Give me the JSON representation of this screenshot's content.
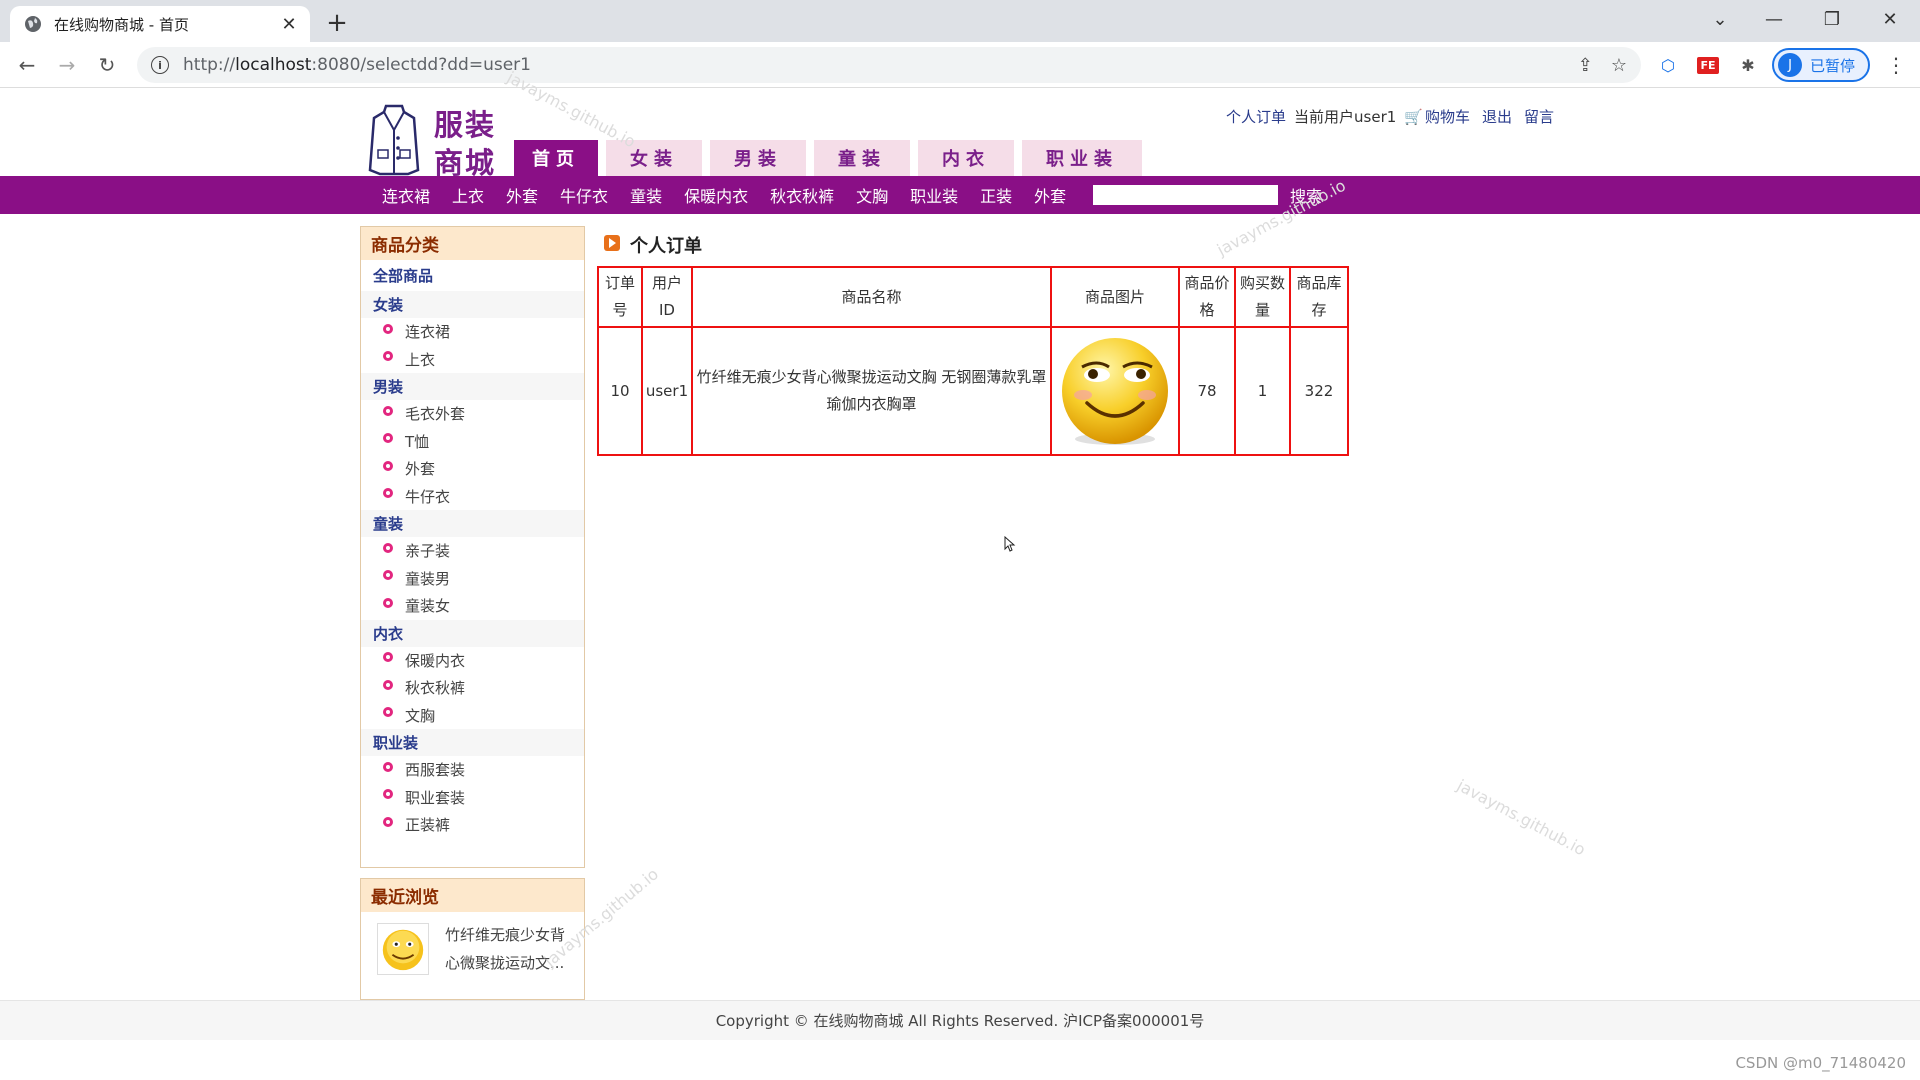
{
  "browser": {
    "tab_title": "在线购物商城 - 首页",
    "url_prefix": "http://",
    "url_host": "localhost",
    "url_rest": ":8080/selectdd?dd=user1",
    "profile_initial": "J",
    "profile_label": "已暂停",
    "ext_label": "FE"
  },
  "site": {
    "logo_line1": "服装",
    "logo_line2": "商城",
    "toplinks": {
      "my_orders": "个人订单",
      "current_user": "当前用户user1",
      "cart": "购物车",
      "logout": "退出",
      "message": "留言"
    },
    "main_tabs": [
      {
        "label": "首页"
      },
      {
        "label": "女装"
      },
      {
        "label": "男装"
      },
      {
        "label": "童装"
      },
      {
        "label": "内衣"
      },
      {
        "label": "职业装"
      }
    ],
    "sub_nav": [
      "连衣裙",
      "上衣",
      "外套",
      "牛仔衣",
      "童装",
      "保暖内衣",
      "秋衣秋裤",
      "文胸",
      "职业装",
      "正装",
      "外套"
    ],
    "search_button": "搜索"
  },
  "sidebar": {
    "title": "商品分类",
    "all": "全部商品",
    "categories": [
      {
        "name": "女装",
        "items": [
          "连衣裙",
          "上衣"
        ]
      },
      {
        "name": "男装",
        "items": [
          "毛衣外套",
          "T恤",
          "外套",
          "牛仔衣"
        ]
      },
      {
        "name": "童装",
        "items": [
          "亲子装",
          "童装男",
          "童装女"
        ]
      },
      {
        "name": "内衣",
        "items": [
          "保暖内衣",
          "秋衣秋裤",
          "文胸"
        ]
      },
      {
        "name": "职业装",
        "items": [
          "西服套装",
          "职业套装",
          "正装裤"
        ]
      }
    ]
  },
  "recent": {
    "title": "最近浏览",
    "item_text": "竹纤维无痕少女背心微聚拢运动文..."
  },
  "orders": {
    "title": "个人订单",
    "headers": [
      {
        "line1": "订单",
        "line2": "号"
      },
      {
        "line1": "用户",
        "line2": "ID"
      },
      {
        "line1": "商品名称",
        "line2": ""
      },
      {
        "line1": "商品图片",
        "line2": ""
      },
      {
        "line1": "商品价",
        "line2": "格"
      },
      {
        "line1": "购买数",
        "line2": "量"
      },
      {
        "line1": "商品库",
        "line2": "存"
      }
    ],
    "rows": [
      {
        "order_no": "10",
        "user_id": "user1",
        "name_line1": "竹纤维无痕少女背心微聚拢运动文胸 无钢圈薄款乳罩",
        "name_line2": "瑜伽内衣胸罩",
        "price": "78",
        "qty": "1",
        "stock": "322"
      }
    ]
  },
  "footer": "Copyright © 在线购物商城 All Rights Reserved. 沪ICP备案000001号",
  "watermark": "javayms.github.io",
  "csdn": "CSDN @m0_71480420"
}
